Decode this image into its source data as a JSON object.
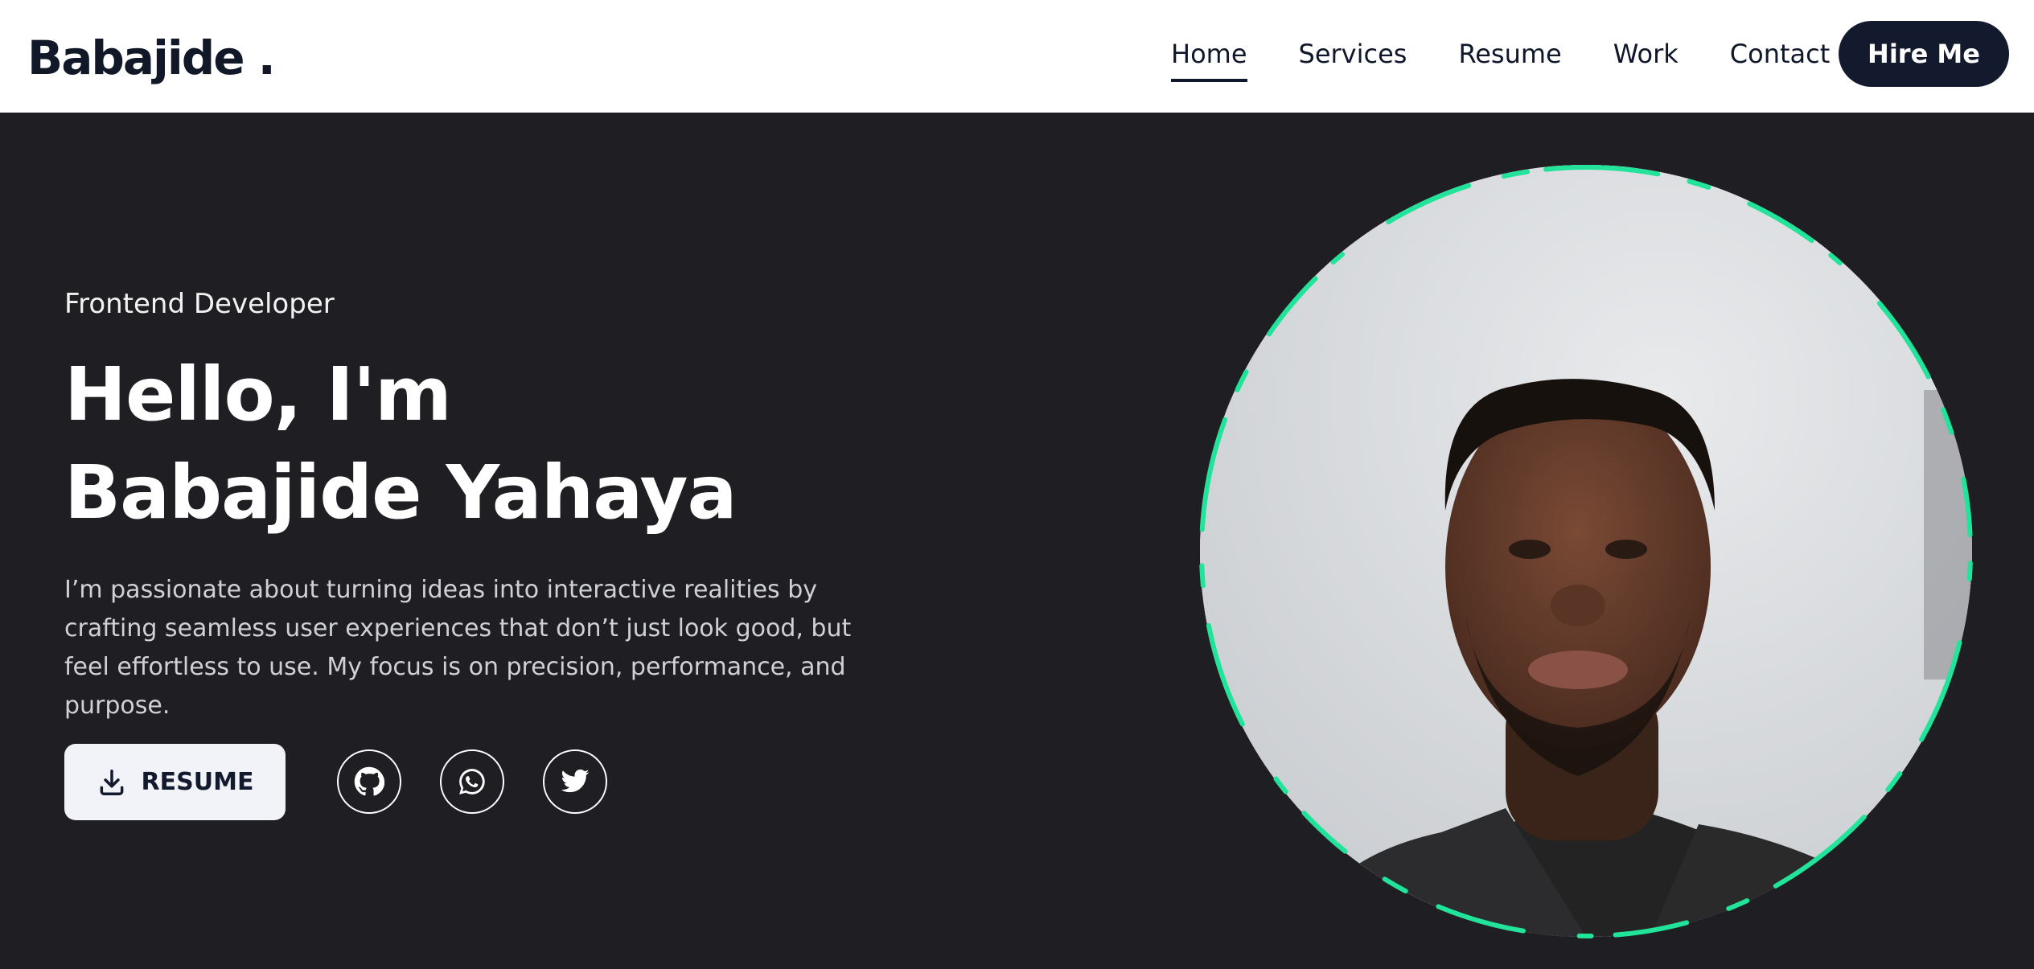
{
  "logo": "Babajide .",
  "nav": {
    "links": [
      "Home",
      "Services",
      "Resume",
      "Work",
      "Contact"
    ],
    "active": "Home",
    "cta": "Hire Me"
  },
  "hero": {
    "role": "Frontend Developer",
    "headline_line1": "Hello, I'm",
    "headline_line2": "Babajide Yahaya",
    "bio": "I’m passionate about turning ideas into interactive realities by crafting seamless user experiences that don’t just look good, but feel effortless to use. My focus is on precision, performance, and purpose.",
    "resume_button": "RESUME"
  },
  "social": [
    "github-icon",
    "whatsapp-icon",
    "twitter-icon"
  ],
  "colors": {
    "page_bg": "#1f1e23",
    "nav_bg": "#ffffff",
    "brand_dark": "#141a2e",
    "accent_ring": "#22e39a"
  }
}
